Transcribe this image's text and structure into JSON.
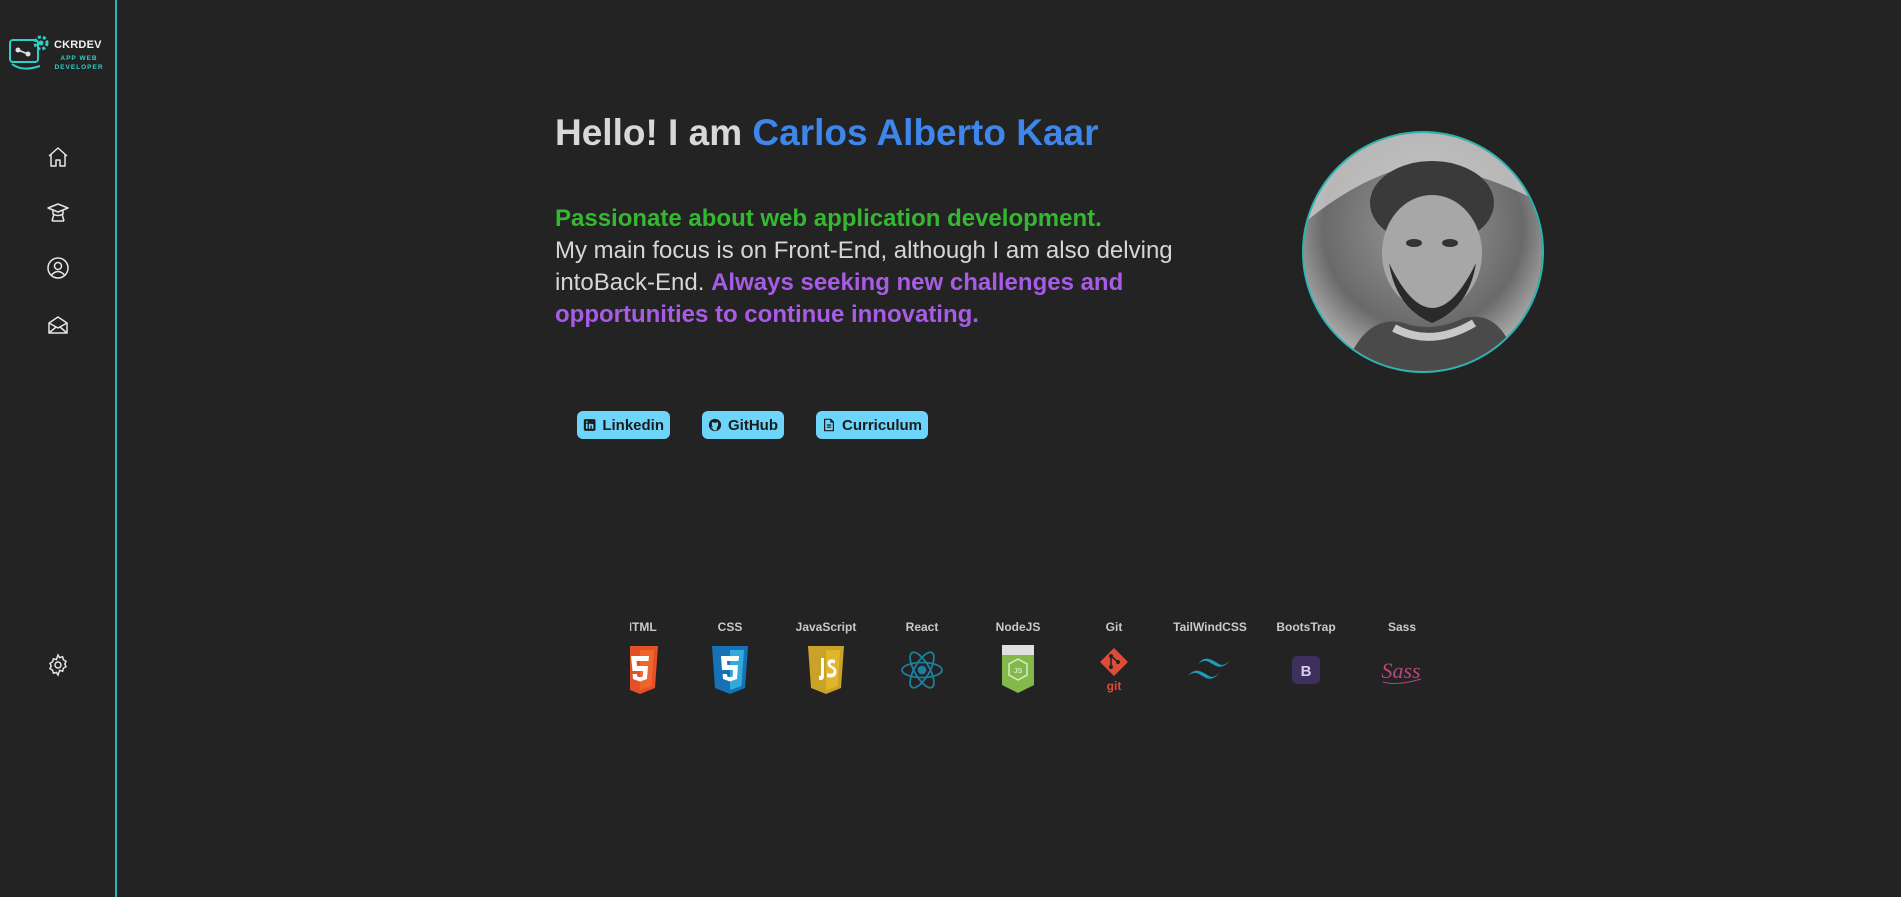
{
  "brand": {
    "title": "CKRDEV",
    "subtitle": "APP WEB DEVELOPER"
  },
  "nav": {
    "items": [
      {
        "icon": "home-icon"
      },
      {
        "icon": "graduation-cap-icon"
      },
      {
        "icon": "user-icon"
      },
      {
        "icon": "mail-icon"
      }
    ],
    "settings_icon": "gear-icon"
  },
  "hero": {
    "greeting": "Hello! I am ",
    "name": "Carlos Alberto Kaar",
    "tagline": "Passionate about web application development.",
    "focus": "My main focus is on Front-End, although I am also delving intoBack-End. ",
    "challenge": "Always seeking new challenges and opportunities to continue innovating."
  },
  "links": [
    {
      "label": "Linkedin",
      "icon": "linkedin-icon"
    },
    {
      "label": "GitHub",
      "icon": "github-icon"
    },
    {
      "label": "Curriculum",
      "icon": "document-icon"
    }
  ],
  "tech": [
    {
      "label": "HTML",
      "icon": "html5-icon"
    },
    {
      "label": "CSS",
      "icon": "css3-icon"
    },
    {
      "label": "JavaScript",
      "icon": "javascript-icon"
    },
    {
      "label": "React",
      "icon": "react-icon"
    },
    {
      "label": "NodeJS",
      "icon": "nodejs-icon"
    },
    {
      "label": "Git",
      "icon": "git-icon"
    },
    {
      "label": "TailWindCSS",
      "icon": "tailwind-icon"
    },
    {
      "label": "BootsTrap",
      "icon": "bootstrap-icon"
    },
    {
      "label": "Sass",
      "icon": "sass-icon"
    }
  ],
  "colors": {
    "accent_teal": "#2bb5b0",
    "name_blue": "#3f86ec",
    "tagline_green": "#35b731",
    "highlight_purple": "#a85be6",
    "button_bg": "#6dd5fa",
    "background": "#232323"
  }
}
